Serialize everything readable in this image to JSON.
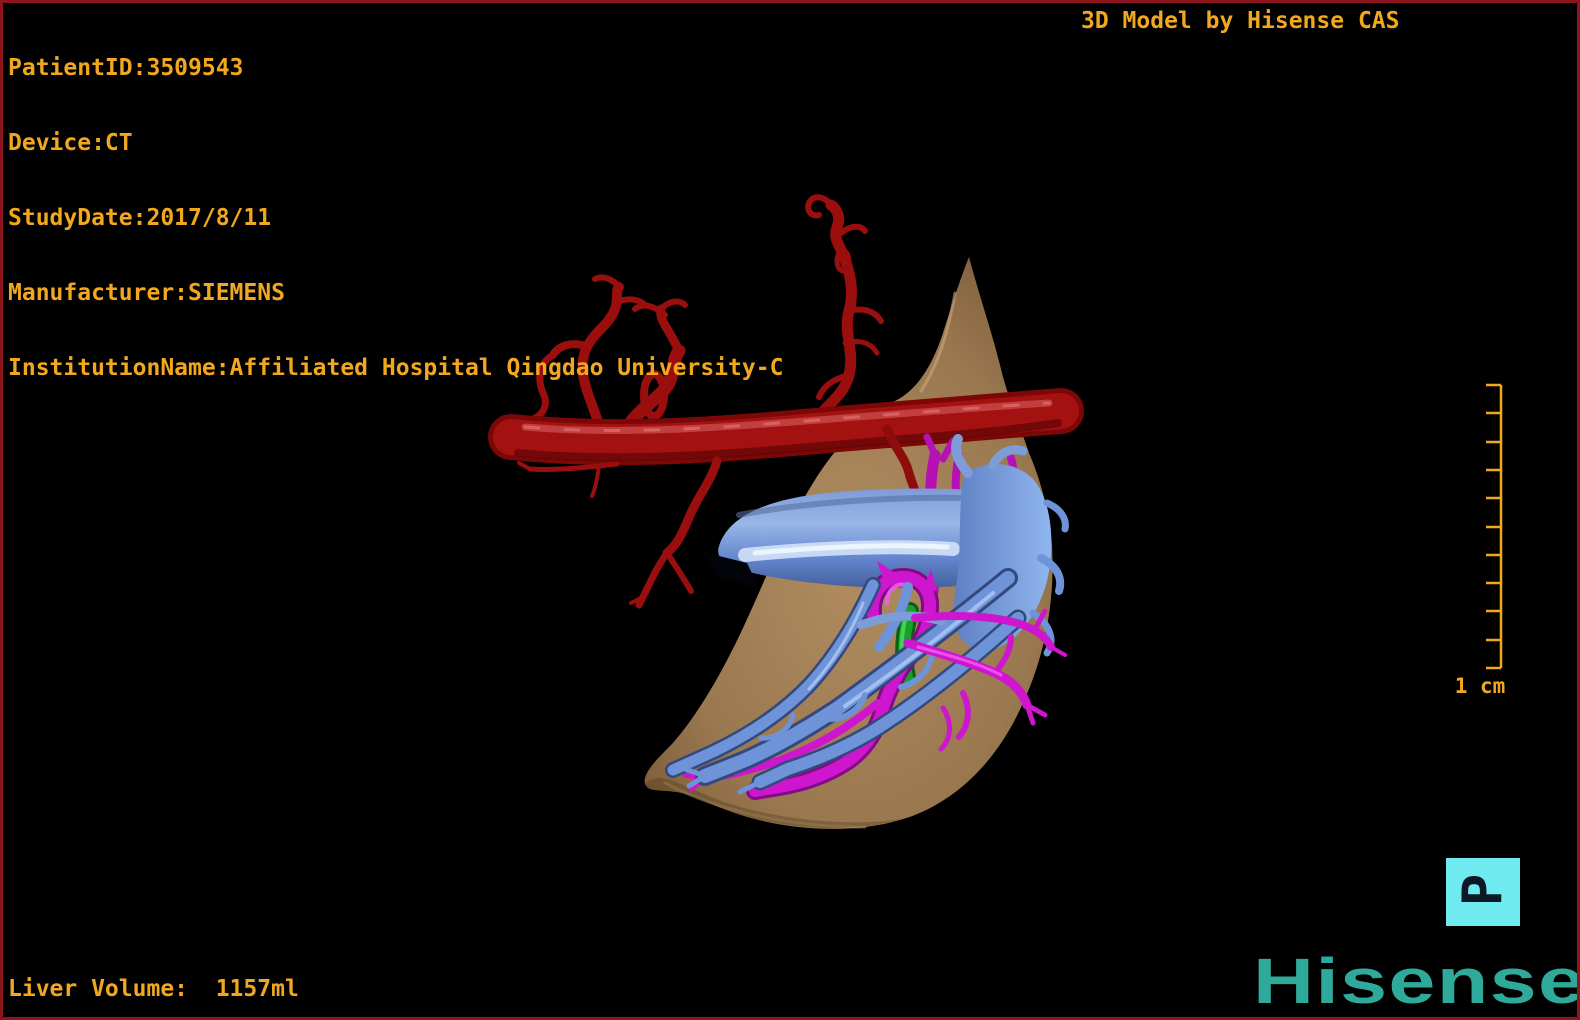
{
  "window": {
    "background": "#000000",
    "frame_color": "#8B151B"
  },
  "overlay": {
    "text_color": "#F2A81E",
    "patient_lines": [
      "PatientID:3509543",
      "Device:CT",
      "StudyDate:2017/8/11",
      "Manufacturer:SIEMENS",
      "InstitutionName:Affiliated Hospital Qingdao University-C"
    ],
    "title": "3D Model by Hisense CAS",
    "liver_volume": "Liver Volume:  1157ml"
  },
  "ruler": {
    "label": "1 cm",
    "tick_count": 11,
    "color": "#F2A81E"
  },
  "orientation_marker": {
    "letter": "P",
    "box_color": "#6FEBF0",
    "glyph_color": "#0A1925"
  },
  "logo": {
    "text": "Hisense",
    "color": "#2FA99A"
  },
  "model": {
    "structures": [
      {
        "name": "liver",
        "color": "#A08052"
      },
      {
        "name": "hepatic-artery",
        "color": "#A31111"
      },
      {
        "name": "portal-vein",
        "color": "#6E93D8"
      },
      {
        "name": "vessels-magenta",
        "color": "#CE16CE"
      },
      {
        "name": "bile-duct",
        "color": "#17A12B"
      }
    ]
  }
}
